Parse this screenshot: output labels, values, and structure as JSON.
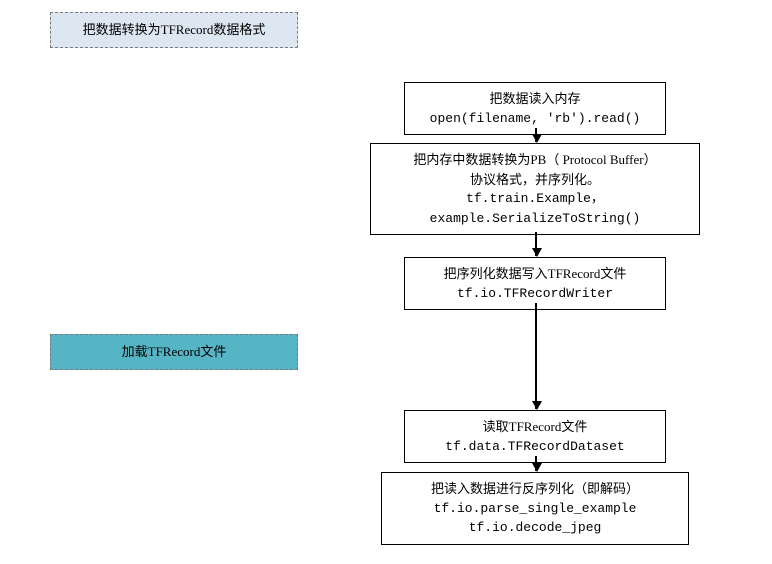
{
  "headers": {
    "convert": "把数据转换为TFRecord数据格式",
    "load": "加载TFRecord文件"
  },
  "steps": {
    "s1": {
      "title": "把数据读入内存",
      "code1": "open(filename, 'rb').read()"
    },
    "s2": {
      "title1": "把内存中数据转换为PB（ Protocol Buffer）",
      "title2": "协议格式，并序列化。",
      "code1": "tf.train.Example，",
      "code2": "example.SerializeToString()"
    },
    "s3": {
      "title": "把序列化数据写入TFRecord文件",
      "code1": "tf.io.TFRecordWriter"
    },
    "s4": {
      "title": "读取TFRecord文件",
      "code1": "tf.data.TFRecordDataset"
    },
    "s5": {
      "title": "把读入数据进行反序列化（即解码）",
      "code1": "tf.io.parse_single_example",
      "code2": "tf.io.decode_jpeg"
    }
  }
}
